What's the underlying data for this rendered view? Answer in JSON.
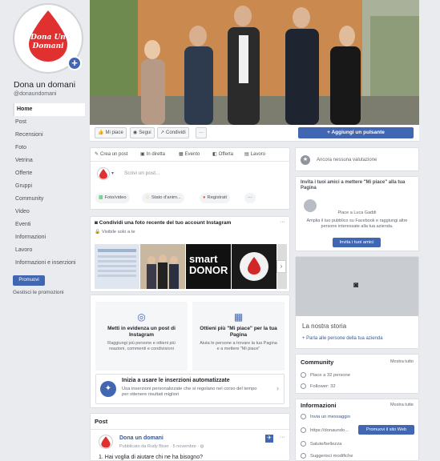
{
  "page": {
    "logo_text": [
      "Dona Un",
      "Domani"
    ],
    "name": "Dona un domani",
    "handle": "@donaundomani"
  },
  "nav": [
    "Home",
    "Post",
    "Recensioni",
    "Foto",
    "Vetrina",
    "Offerte",
    "Gruppi",
    "Community",
    "Video",
    "Eventi",
    "Informazioni",
    "Lavoro",
    "Informazioni e inserzioni"
  ],
  "promote_button": "Promuovi",
  "manage_promotions": "Gestisci le promozioni",
  "actions": {
    "like": "Mi piace",
    "follow": "Segui",
    "share": "Condividi",
    "more": "···",
    "add_button": "+ Aggiungi un pulsante"
  },
  "composer": {
    "tabs": [
      "Crea un post",
      "In diretta",
      "Evento",
      "Offerta",
      "Lavoro"
    ],
    "placeholder": "Scrivi un post...",
    "chips": [
      "Foto/video",
      "Stato d'anim...",
      "Registrati",
      "···"
    ]
  },
  "instagram": {
    "title": "Condividi una foto recente del tuo account Instagram",
    "visibility": "Visibile solo a te",
    "thumbs": [
      "",
      "",
      "smart DONOR",
      "",
      ""
    ]
  },
  "promos": [
    {
      "title": "Metti in evidenza un post di Instagram",
      "desc": "Raggiungi più persone e ottieni più reazioni, commenti e condivisioni"
    },
    {
      "title": "Ottieni più \"Mi piace\" per la tua Pagina",
      "desc": "Aiuta le persone a trovare la tua Pagina e a mettere \"Mi piace\""
    }
  ],
  "automated_ads": {
    "title": "Inizia a usare le inserzioni automatizzate",
    "desc": "Usa inserzioni personalizzate che si regolano nel corso del tempo per ottenere risultati migliori"
  },
  "posts": {
    "header": "Post",
    "author": "Dona un domani",
    "meta_published": "Pubblicato da Rudy Biser",
    "meta_date": "5 novembre",
    "first_line": "1. Hai voglia di aiutare chi ne ha bisogno?"
  },
  "right": {
    "rating": "Ancora nessuna valutazione",
    "invite_title": "Invita i tuoi amici a mettere \"Mi piace\" alla tua Pagina",
    "invite_like": "Piace a Luca Gaddi",
    "invite_desc": "Amplia il tuo pubblico su Facebook e raggiungi altre persone interessate alla tua azienda.",
    "invite_btn": "Invita i tuoi amici",
    "story_title": "La nostra storia",
    "story_link": "+ Parla alle persone della tua azienda",
    "community_title": "Community",
    "community_all": "Mostra tutto",
    "community_rows": [
      "Piace a 32 persone",
      "Follower: 32"
    ],
    "info_title": "Informazioni",
    "info_all": "Mostra tutte",
    "info_rows": [
      "Invia un messaggio",
      "https://donaundo...",
      "Salute/bellezza",
      "Suggerisci modifiche"
    ],
    "info_btn": "Promuovi il sito Web"
  },
  "colors": {
    "brand_blue": "#4267b2",
    "logo_red": "#e03030"
  }
}
